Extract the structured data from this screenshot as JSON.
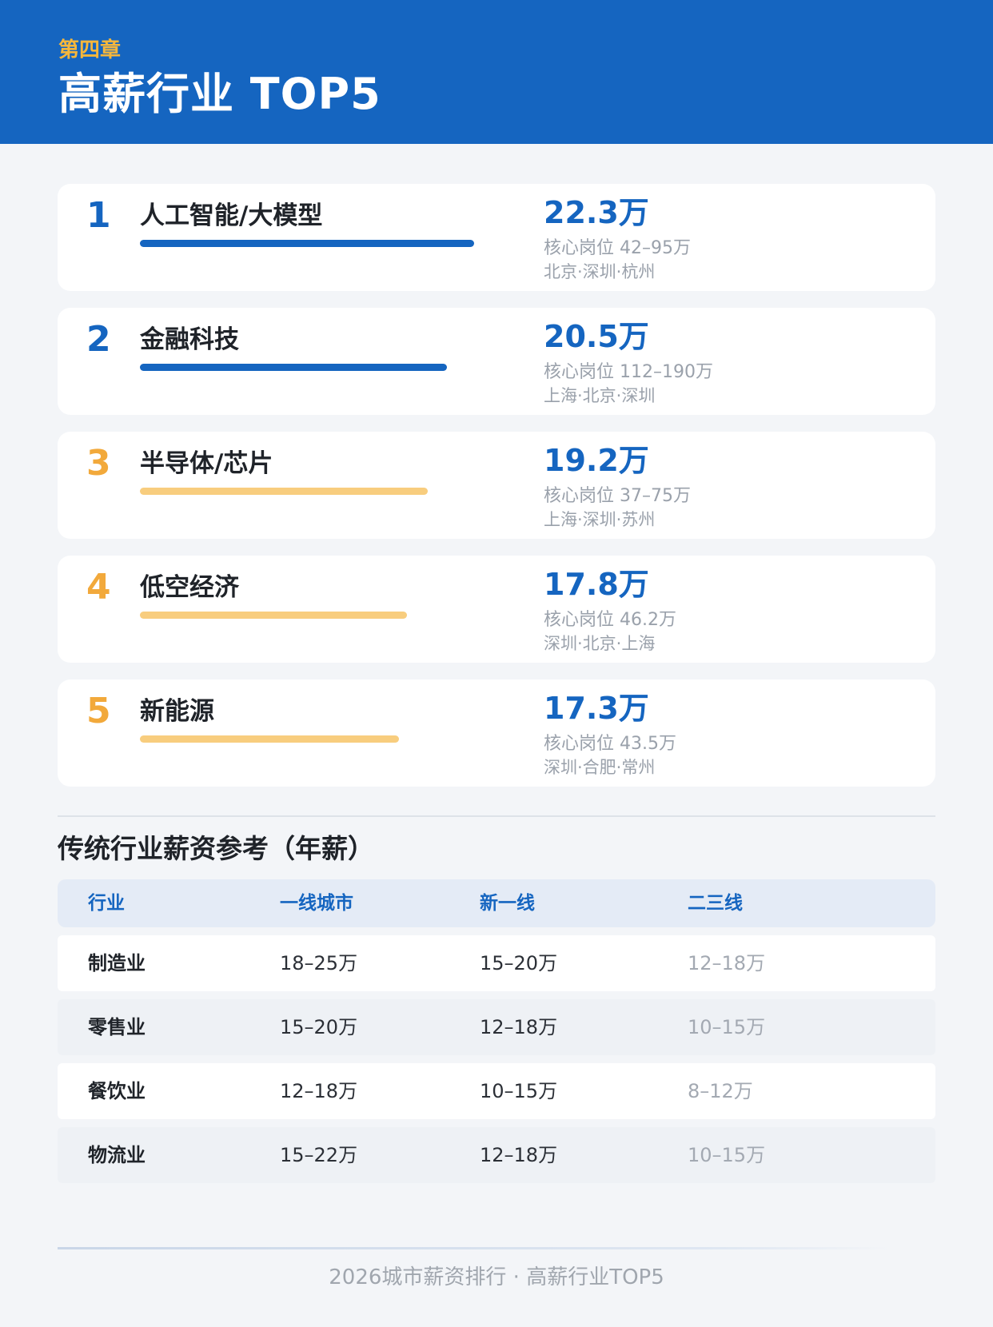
{
  "header": {
    "chapter": "第四章",
    "title": "高薪行业 TOP5"
  },
  "rankings": [
    {
      "rank": "1",
      "name": "人工智能/大模型",
      "salary": "22.3万",
      "core": "核心岗位 42–95万",
      "cities": "北京·深圳·杭州",
      "bar_fraction": 1.0,
      "color": "#1565c0"
    },
    {
      "rank": "2",
      "name": "金融科技",
      "salary": "20.5万",
      "core": "核心岗位 112–190万",
      "cities": "上海·北京·深圳",
      "bar_fraction": 0.919,
      "color": "#1565c0"
    },
    {
      "rank": "3",
      "name": "半导体/芯片",
      "salary": "19.2万",
      "core": "核心岗位 37–75万",
      "cities": "上海·深圳·苏州",
      "bar_fraction": 0.861,
      "color": "#f8cd7e"
    },
    {
      "rank": "4",
      "name": "低空经济",
      "salary": "17.8万",
      "core": "核心岗位 46.2万",
      "cities": "深圳·北京·上海",
      "bar_fraction": 0.798,
      "color": "#f8cd7e"
    },
    {
      "rank": "5",
      "name": "新能源",
      "salary": "17.3万",
      "core": "核心岗位 43.5万",
      "cities": "深圳·合肥·常州",
      "bar_fraction": 0.776,
      "color": "#f8cd7e"
    }
  ],
  "traditional": {
    "title": "传统行业薪资参考（年薪）",
    "headers": [
      "行业",
      "一线城市",
      "新一线",
      "二三线"
    ],
    "rows": [
      [
        "制造业",
        "18–25万",
        "15–20万",
        "12–18万"
      ],
      [
        "零售业",
        "15–20万",
        "12–18万",
        "10–15万"
      ],
      [
        "餐饮业",
        "12–18万",
        "10–15万",
        "8–12万"
      ],
      [
        "物流业",
        "15–22万",
        "12–18万",
        "10–15万"
      ]
    ]
  },
  "footer": {
    "text": "2026城市薪资排行 · 高薪行业TOP5"
  }
}
